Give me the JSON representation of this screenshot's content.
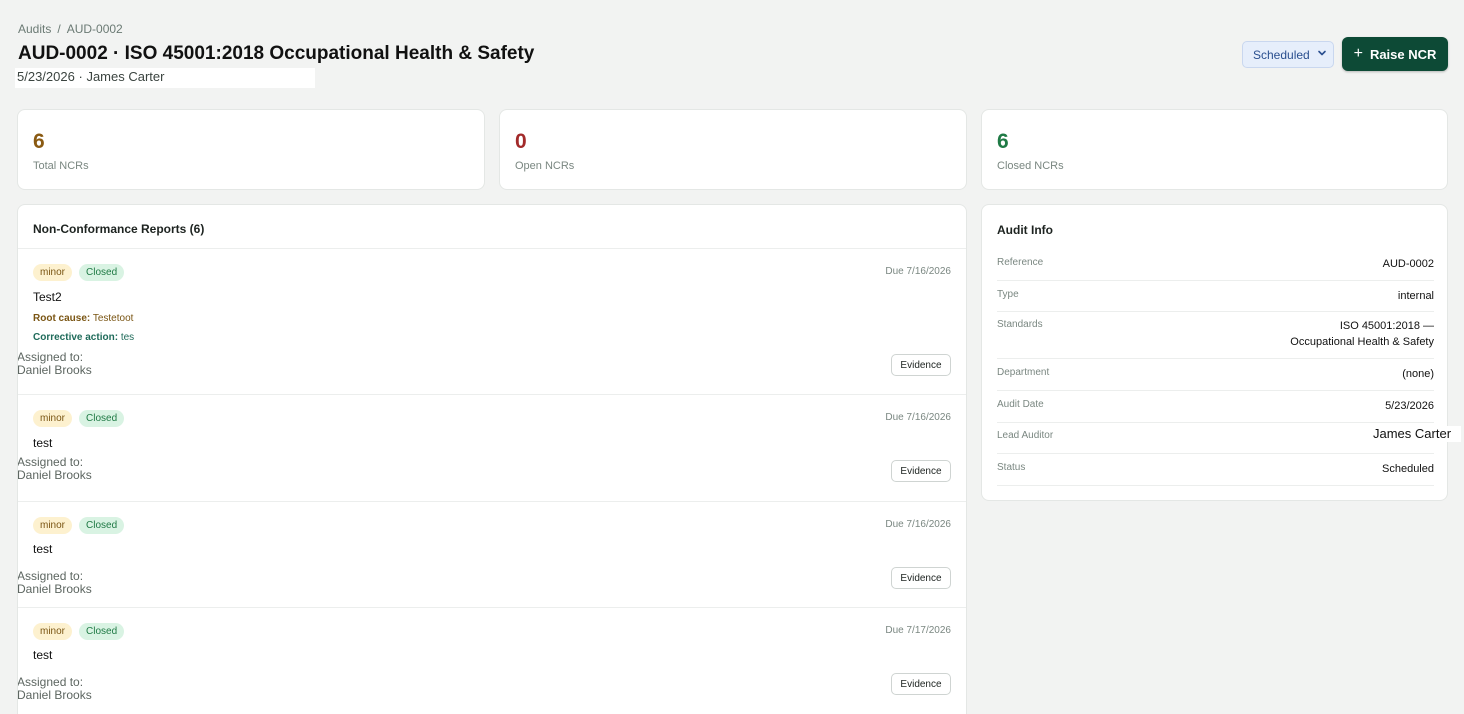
{
  "breadcrumb": {
    "root": "Audits",
    "separator": "/",
    "current": "AUD-0002"
  },
  "header": {
    "title": "AUD-0002 · ISO 45001:2018 Occupational Health & Safety",
    "subtitle_date": "5/23/2026",
    "subtitle_sep": "·",
    "subtitle_auditor": "James Carter"
  },
  "actions": {
    "status_value": "Scheduled",
    "raise_label": "Raise NCR",
    "raise_icon": "plus-icon"
  },
  "stats": [
    {
      "value": "6",
      "label": "Total NCRs",
      "color": "#8a5a12"
    },
    {
      "value": "0",
      "label": "Open NCRs",
      "color": "#a22a2a"
    },
    {
      "value": "6",
      "label": "Closed NCRs",
      "color": "#1f7a45"
    }
  ],
  "ncr_panel": {
    "title": "Non-Conformance Reports (6)",
    "items": [
      {
        "severity": "minor",
        "status": "Closed",
        "due": "Due 7/16/2026",
        "title": "Test2",
        "root_cause_label": "Root cause:",
        "root_cause": "Testetoot",
        "corrective_label": "Corrective action:",
        "corrective": "tes",
        "assigned_label": "Assigned to:",
        "assigned_name": "Daniel Brooks",
        "evidence_label": "Evidence"
      },
      {
        "severity": "minor",
        "status": "Closed",
        "due": "Due 7/16/2026",
        "title": "test",
        "assigned_label": "Assigned to:",
        "assigned_name": "Daniel Brooks",
        "evidence_label": "Evidence"
      },
      {
        "severity": "minor",
        "status": "Closed",
        "due": "Due 7/16/2026",
        "title": "test",
        "assigned_label": "Assigned to:",
        "assigned_name": "Daniel Brooks",
        "evidence_label": "Evidence"
      },
      {
        "severity": "minor",
        "status": "Closed",
        "due": "Due 7/17/2026",
        "title": "test",
        "assigned_label": "Assigned to:",
        "assigned_name": "Daniel Brooks",
        "evidence_label": "Evidence"
      }
    ]
  },
  "audit_info": {
    "title": "Audit Info",
    "rows": [
      {
        "key": "Reference",
        "value": "AUD-0002"
      },
      {
        "key": "Type",
        "value": "internal"
      },
      {
        "key": "Standards",
        "value": "ISO 45001:2018 —",
        "value2": "Occupational Health & Safety"
      },
      {
        "key": "Department",
        "value": "(none)"
      },
      {
        "key": "Audit Date",
        "value": "5/23/2026"
      },
      {
        "key": "Lead Auditor",
        "value": "James Carter"
      },
      {
        "key": "Status",
        "value": "Scheduled"
      }
    ]
  }
}
